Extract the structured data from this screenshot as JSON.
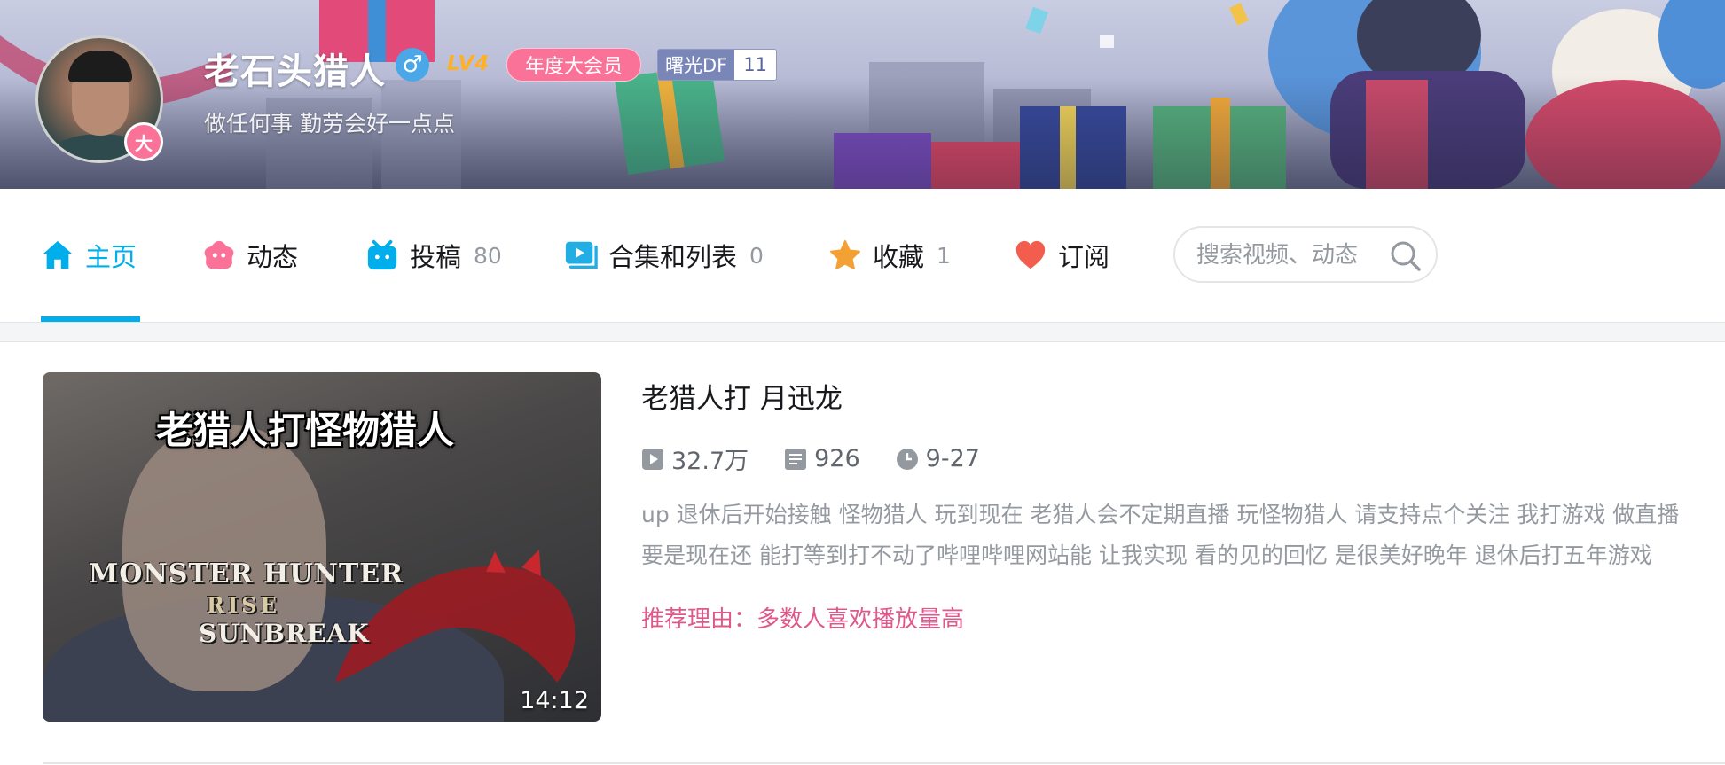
{
  "profile": {
    "username": "老石头猎人",
    "gender_icon": "male-icon",
    "gender_glyph": "♂",
    "level_text": "LV4",
    "vip_label": "年度大会员",
    "avatar_badge": "大",
    "medal": {
      "name": "曙光DF",
      "level": "11"
    },
    "signature": "做任何事 勤劳会好一点点"
  },
  "nav": {
    "items": [
      {
        "label": "主页",
        "count": "",
        "icon": "home-icon",
        "active": true
      },
      {
        "label": "动态",
        "count": "",
        "icon": "dynamic-icon",
        "active": false
      },
      {
        "label": "投稿",
        "count": "80",
        "icon": "tv-icon",
        "active": false
      },
      {
        "label": "合集和列表",
        "count": "0",
        "icon": "collection-icon",
        "active": false
      },
      {
        "label": "收藏",
        "count": "1",
        "icon": "star-icon",
        "active": false
      },
      {
        "label": "订阅",
        "count": "",
        "icon": "heart-icon",
        "active": false
      }
    ],
    "search": {
      "placeholder": "搜索视频、动态",
      "value": ""
    }
  },
  "featured_video": {
    "thumbnail_caption": "老猎人打怪物猎人",
    "thumbnail_logo": [
      "MONSTER HUNTER",
      "RISE",
      "SUNBREAK"
    ],
    "duration": "14:12",
    "title": "老猎人打 月迅龙",
    "plays": "32.7万",
    "danmaku": "926",
    "date": "9-27",
    "description_lines": [
      "up 退休后开始接触 怪物猎人 玩到现在 老猎人会不定期直播 玩怪物猎人 请支持点个关注 我打游戏 做直播",
      "要是现在还 能打等到打不动了哔哩哔哩网站能 让我实现  看的见的回忆  是很美好晚年 退休后打五年游戏"
    ],
    "recommend_reason": "推荐理由：多数人喜欢播放量高"
  },
  "colors": {
    "accent": "#00aeec",
    "vip_pink": "#fb7299",
    "reason_pink": "#e0578a",
    "gender_blue": "#4aa7e8",
    "level_orange": "#ffb027"
  }
}
